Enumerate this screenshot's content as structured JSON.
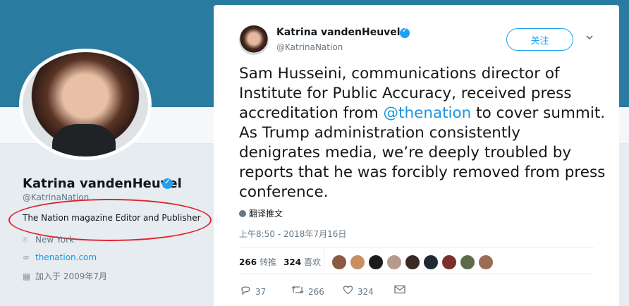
{
  "profile": {
    "name": "Katrina vandenHeuvel",
    "handle": "@KatrinaNation",
    "bio": "The Nation magazine Editor and Publisher",
    "location": "New York",
    "website": "thenation.com",
    "joined": "加入于 2009年7月"
  },
  "tweet": {
    "author_name": "Katrina vandenHeuvel",
    "author_handle": "@KatrinaNation",
    "follow_label": "关注",
    "text_before": "Sam Husseini, communications director of Institute for Public Accuracy, received press accreditation from ",
    "mention": "@thenation",
    "text_after": " to cover summit. As Trump administration consistently denigrates media, we’re deeply troubled by reports that he was forcibly removed from press conference.",
    "translate_label": "翻译推文",
    "timestamp": "上午8:50 - 2018年7月16日",
    "retweets_count": "266",
    "retweets_label": "转推",
    "likes_count": "324",
    "likes_label": "喜欢",
    "actions": {
      "reply_count": "37",
      "retweet_count": "266",
      "like_count": "324"
    }
  },
  "colors": {
    "accent": "#1da1f2",
    "link": "#1b95e0",
    "banner": "#2a7ba0",
    "annotation_oval": "#e0242e"
  },
  "icons": [
    "verified-badge-icon",
    "chevron-down-icon",
    "globe-icon",
    "location-pin-icon",
    "link-icon",
    "calendar-icon",
    "reply-icon",
    "retweet-icon",
    "heart-icon",
    "message-icon"
  ]
}
